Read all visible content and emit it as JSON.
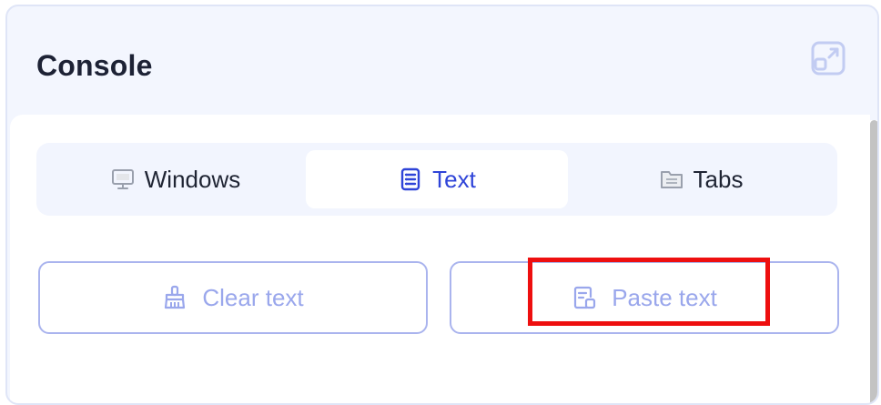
{
  "panel": {
    "title": "Console",
    "popout_icon": "popout-icon"
  },
  "tabs": [
    {
      "label": "Windows",
      "icon": "monitor-icon",
      "active": false
    },
    {
      "label": "Text",
      "icon": "document-lines-icon",
      "active": true
    },
    {
      "label": "Tabs",
      "icon": "folder-icon",
      "active": false
    }
  ],
  "actions": {
    "clear_label": "Clear text",
    "clear_icon": "broom-icon",
    "paste_label": "Paste text",
    "paste_icon": "paste-document-icon"
  },
  "colors": {
    "accent": "#2f44d8",
    "button_text": "#9aa7ec",
    "button_border": "#aab4ee",
    "highlight": "#ee0f0f",
    "panel_bg": "#f3f6fe"
  }
}
